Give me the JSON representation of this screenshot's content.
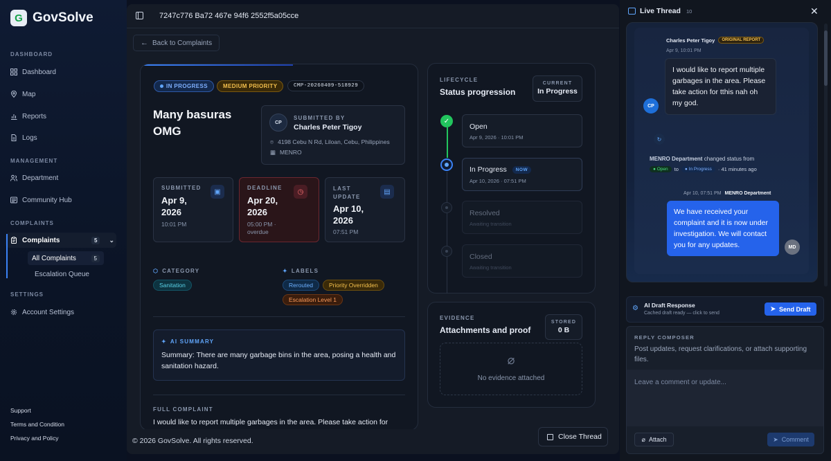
{
  "app": {
    "name": "GovSolve",
    "logo_letter": "G"
  },
  "sidebar": {
    "sections": [
      {
        "label": "DASHBOARD"
      },
      {
        "label": "MANAGEMENT"
      },
      {
        "label": "COMPLAINTS"
      },
      {
        "label": "SETTINGS"
      }
    ],
    "items": {
      "dashboard": "Dashboard",
      "map": "Map",
      "reports": "Reports",
      "logs": "Logs",
      "department": "Department",
      "community_hub": "Community Hub",
      "complaints": "Complaints",
      "complaints_count": "5",
      "all_complaints": "All Complaints",
      "all_complaints_count": "5",
      "escalation_queue": "Escalation Queue",
      "account_settings": "Account Settings"
    },
    "footer": [
      "Support",
      "Terms and Condition",
      "Privacy and Policy"
    ]
  },
  "header": {
    "complaint_id": "7247c776 Ba72 467e 94f6 2552f5a05cce",
    "back_label": "Back to Complaints"
  },
  "complaint": {
    "status": "IN PROGRESS",
    "priority": "MEDIUM PRIORITY",
    "code": "CMP-20260409-518929",
    "title_line1": "Many basuras",
    "title_line2": "OMG",
    "submitted_by_label": "SUBMITTED BY",
    "submitter_initials": "CP",
    "submitter_name": "Charles Peter Tigoy",
    "address": "4198 Cebu N Rd, Liloan, Cebu, Philippines",
    "department": "MENRO",
    "dates": {
      "submitted_label": "SUBMITTED",
      "submitted_line1": "Apr 9,",
      "submitted_line2": "2026",
      "submitted_time": "10:01 PM",
      "deadline_label": "DEADLINE",
      "deadline_line1": "Apr 20,",
      "deadline_line2": "2026",
      "deadline_time": "05:00 PM ·",
      "deadline_note": "overdue",
      "update_label_1": "LAST",
      "update_label_2": "UPDATE",
      "update_line1": "Apr 10,",
      "update_line2": "2026",
      "update_time": "07:51 PM"
    },
    "category_label": "CATEGORY",
    "category": "Sanitation",
    "labels_label": "LABELS",
    "labels": [
      "Rerouted",
      "Priority Overridden",
      "Escalation Level 1"
    ],
    "ai_summary_label": "AI SUMMARY",
    "ai_summary": "Summary: There are many garbage bins in the area, posing a health and sanitation hazard.",
    "full_complaint_label": "FULL COMPLAINT",
    "full_complaint": "I would like to report multiple garbages in the area. Please take action for"
  },
  "lifecycle": {
    "label": "LIFECYCLE",
    "title": "Status progression",
    "current_label": "CURRENT",
    "current_value": "In Progress",
    "steps": [
      {
        "name": "Open",
        "sub": "Apr 9, 2026 · 10:01 PM"
      },
      {
        "name": "In Progress",
        "badge": "NOW",
        "sub": "Apr 10, 2026 · 07:51 PM"
      },
      {
        "name": "Resolved",
        "sub": "Awaiting transition"
      },
      {
        "name": "Closed",
        "sub": "Awaiting transition"
      }
    ]
  },
  "evidence": {
    "label": "EVIDENCE",
    "title": "Attachments and proof",
    "stored_label": "STORED",
    "stored_value": "0 B",
    "empty_text": "No evidence attached"
  },
  "footer": {
    "copyright": "© 2026 GovSolve. All rights reserved.",
    "close_thread": "Close Thread"
  },
  "thread": {
    "title": "Live Thread",
    "count": "10",
    "msg1": {
      "author": "Charles Peter Tigoy",
      "tag": "ORIGINAL REPORT",
      "time": "Apr 9, 10:01 PM",
      "text": "I would like to report multiple garbages in the area. Please take action for tthis nah oh my god.",
      "initials": "CP"
    },
    "status_change": {
      "dept": "MENRO Department",
      "text": "changed status from",
      "from": "Open",
      "to_word": "to",
      "to": "In Progress",
      "ago": "· 41 minutes ago"
    },
    "msg2": {
      "time": "Apr 10, 07:51 PM",
      "author": "MENRO Department",
      "text": "We have received your complaint and it is now under investigation. We will contact you for any updates.",
      "initials": "MD"
    },
    "ai_draft": {
      "title": "AI Draft Response",
      "sub": "Cached draft ready — click to send",
      "button": "Send Draft"
    },
    "composer": {
      "label": "REPLY COMPOSER",
      "help": "Post updates, request clarifications, or attach supporting files.",
      "placeholder": "Leave a comment or update...",
      "attach": "Attach",
      "comment": "Comment"
    }
  },
  "colors": {
    "accent": "#2563eb",
    "success": "#22c55e",
    "warning": "#f59e0b",
    "danger": "#ef4444",
    "bg": "#0b1120"
  }
}
